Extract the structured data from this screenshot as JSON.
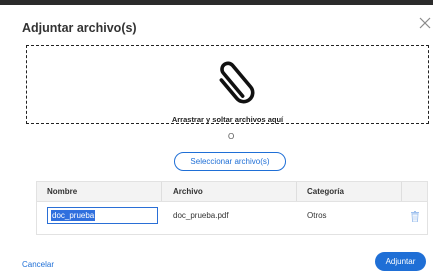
{
  "dialog": {
    "title": "Adjuntar archivo(s)",
    "close_icon": "close-icon"
  },
  "dropzone": {
    "icon": "paperclip-icon",
    "text": "Arrastrar y soltar archivos aquí"
  },
  "separator_text": "O",
  "select_button_label": "Seleccionar archivo(s)",
  "table": {
    "headers": {
      "name": "Nombre",
      "file": "Archivo",
      "category": "Categoría"
    },
    "rows": [
      {
        "name_value": "doc_prueba",
        "file": "doc_prueba.pdf",
        "category": "Otros",
        "delete_icon": "trash-icon"
      }
    ]
  },
  "footer": {
    "cancel_label": "Cancelar",
    "submit_label": "Adjuntar"
  },
  "colors": {
    "accent": "#1f6fd6",
    "selection": "#2f6fde",
    "header_bg": "#f3f3f3",
    "frame": "#2b2b2b"
  }
}
